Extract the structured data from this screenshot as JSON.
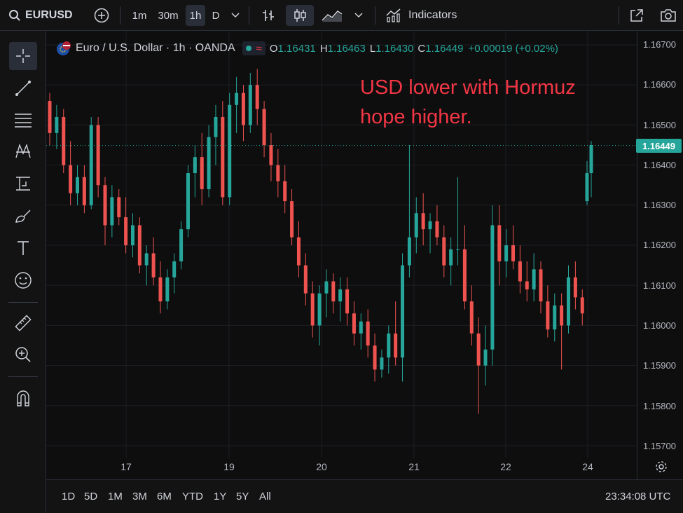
{
  "toolbar": {
    "symbol": "EURUSD",
    "intervals": [
      "1m",
      "30m",
      "1h",
      "D"
    ],
    "active_interval": "1h",
    "indicators_label": "Indicators"
  },
  "legend": {
    "title": "Euro / U.S. Dollar · 1h · OANDA",
    "o_label": "O",
    "o_value": "1.16431",
    "h_label": "H",
    "h_value": "1.16463",
    "l_label": "L",
    "l_value": "1.16430",
    "c_label": "C",
    "c_value": "1.16449",
    "change": "+0.00019 (+0.02%)"
  },
  "annotation": "USD lower with Hormuz hope higher.",
  "price_axis": {
    "ticks": [
      "1.16700",
      "1.16600",
      "1.16500",
      "1.16400",
      "1.16300",
      "1.16200",
      "1.16100",
      "1.16000",
      "1.15900",
      "1.15800",
      "1.15700"
    ],
    "last_price": "1.16449"
  },
  "time_axis": {
    "labels": [
      "17",
      "19",
      "20",
      "21",
      "22",
      "24"
    ]
  },
  "ranges": [
    "1D",
    "5D",
    "1M",
    "3M",
    "6M",
    "YTD",
    "1Y",
    "5Y",
    "All"
  ],
  "clock": "23:34:08 UTC",
  "colors": {
    "up": "#26a69a",
    "down": "#ef5350",
    "annotation": "#f23645",
    "price_label": "#26a69a"
  },
  "chart_data": {
    "type": "candlestick",
    "y_range": [
      1.1565,
      1.1675
    ],
    "last_price": 1.16449,
    "x_labels": [
      "17",
      "19",
      "20",
      "21",
      "22",
      "24"
    ],
    "ohlc": [
      [
        1.1656,
        1.1658,
        1.1645,
        1.1648
      ],
      [
        1.1648,
        1.1655,
        1.1644,
        1.1652
      ],
      [
        1.1652,
        1.1654,
        1.1638,
        1.164
      ],
      [
        1.164,
        1.1646,
        1.163,
        1.1633
      ],
      [
        1.1633,
        1.164,
        1.163,
        1.1637
      ],
      [
        1.1637,
        1.164,
        1.1628,
        1.163
      ],
      [
        1.163,
        1.1652,
        1.1629,
        1.165
      ],
      [
        1.165,
        1.1652,
        1.1632,
        1.1635
      ],
      [
        1.1635,
        1.1637,
        1.162,
        1.1625
      ],
      [
        1.1625,
        1.1635,
        1.1622,
        1.1632
      ],
      [
        1.1632,
        1.1634,
        1.1625,
        1.1627
      ],
      [
        1.1627,
        1.1632,
        1.1618,
        1.162
      ],
      [
        1.162,
        1.1628,
        1.1617,
        1.1625
      ],
      [
        1.1625,
        1.1627,
        1.1613,
        1.1615
      ],
      [
        1.1615,
        1.162,
        1.161,
        1.1618
      ],
      [
        1.1618,
        1.1622,
        1.161,
        1.1612
      ],
      [
        1.1612,
        1.1616,
        1.1603,
        1.1606
      ],
      [
        1.1606,
        1.1614,
        1.1604,
        1.1612
      ],
      [
        1.1612,
        1.1618,
        1.1608,
        1.1616
      ],
      [
        1.1616,
        1.1626,
        1.1614,
        1.1624
      ],
      [
        1.1624,
        1.164,
        1.1622,
        1.1638
      ],
      [
        1.1638,
        1.1645,
        1.1632,
        1.1642
      ],
      [
        1.1642,
        1.1648,
        1.163,
        1.1634
      ],
      [
        1.1634,
        1.165,
        1.1632,
        1.1647
      ],
      [
        1.1647,
        1.1655,
        1.164,
        1.1652
      ],
      [
        1.1652,
        1.1656,
        1.163,
        1.1632
      ],
      [
        1.1632,
        1.1658,
        1.163,
        1.1655
      ],
      [
        1.1655,
        1.1662,
        1.1648,
        1.1658
      ],
      [
        1.1658,
        1.166,
        1.1646,
        1.165
      ],
      [
        1.165,
        1.1663,
        1.1648,
        1.166
      ],
      [
        1.166,
        1.1664,
        1.165,
        1.1654
      ],
      [
        1.1654,
        1.1656,
        1.1642,
        1.1645
      ],
      [
        1.1645,
        1.1648,
        1.1636,
        1.164
      ],
      [
        1.164,
        1.1644,
        1.1632,
        1.1636
      ],
      [
        1.1636,
        1.164,
        1.1628,
        1.1631
      ],
      [
        1.1631,
        1.1634,
        1.162,
        1.1622
      ],
      [
        1.1622,
        1.1626,
        1.1612,
        1.1615
      ],
      [
        1.1615,
        1.1618,
        1.1605,
        1.1608
      ],
      [
        1.1608,
        1.1611,
        1.1597,
        1.16
      ],
      [
        1.16,
        1.161,
        1.1595,
        1.1608
      ],
      [
        1.1608,
        1.1614,
        1.1602,
        1.1611
      ],
      [
        1.1611,
        1.1613,
        1.1603,
        1.1606
      ],
      [
        1.1606,
        1.1612,
        1.1601,
        1.1609
      ],
      [
        1.1609,
        1.1612,
        1.16,
        1.1603
      ],
      [
        1.1603,
        1.1606,
        1.1595,
        1.1598
      ],
      [
        1.1598,
        1.1603,
        1.1594,
        1.1601
      ],
      [
        1.1601,
        1.1604,
        1.1592,
        1.1595
      ],
      [
        1.1595,
        1.1598,
        1.1586,
        1.1589
      ],
      [
        1.1589,
        1.1594,
        1.1587,
        1.1592
      ],
      [
        1.1592,
        1.16,
        1.1588,
        1.1598
      ],
      [
        1.1598,
        1.1606,
        1.159,
        1.1592
      ],
      [
        1.1592,
        1.1618,
        1.1586,
        1.1615
      ],
      [
        1.1615,
        1.1645,
        1.1612,
        1.1622
      ],
      [
        1.1622,
        1.1632,
        1.1618,
        1.1628
      ],
      [
        1.1628,
        1.1633,
        1.162,
        1.1624
      ],
      [
        1.1624,
        1.1628,
        1.1618,
        1.1626
      ],
      [
        1.1626,
        1.163,
        1.162,
        1.1622
      ],
      [
        1.1622,
        1.1625,
        1.1612,
        1.1615
      ],
      [
        1.1615,
        1.1622,
        1.161,
        1.1619
      ],
      [
        1.1619,
        1.1637,
        1.1615,
        1.1619
      ],
      [
        1.1619,
        1.1625,
        1.1604,
        1.1606
      ],
      [
        1.1606,
        1.161,
        1.1595,
        1.1598
      ],
      [
        1.1598,
        1.1602,
        1.1578,
        1.159
      ],
      [
        1.159,
        1.16,
        1.1585,
        1.1594
      ],
      [
        1.1594,
        1.163,
        1.159,
        1.1625
      ],
      [
        1.1625,
        1.163,
        1.161,
        1.1616
      ],
      [
        1.1616,
        1.1624,
        1.1612,
        1.162
      ],
      [
        1.162,
        1.1625,
        1.1614,
        1.1616
      ],
      [
        1.1616,
        1.162,
        1.1608,
        1.1611
      ],
      [
        1.1611,
        1.1616,
        1.1606,
        1.1609
      ],
      [
        1.1609,
        1.1618,
        1.1606,
        1.1614
      ],
      [
        1.1614,
        1.1616,
        1.1603,
        1.1606
      ],
      [
        1.1606,
        1.161,
        1.1597,
        1.1599
      ],
      [
        1.1599,
        1.1608,
        1.1596,
        1.1605
      ],
      [
        1.1605,
        1.1608,
        1.1589,
        1.16
      ],
      [
        1.16,
        1.1615,
        1.1598,
        1.1612
      ],
      [
        1.1612,
        1.1616,
        1.1604,
        1.1607
      ],
      [
        1.1607,
        1.1609,
        1.16,
        1.1603
      ],
      [
        1.1631,
        1.1641,
        1.163,
        1.1638
      ],
      [
        1.1638,
        1.1646,
        1.1632,
        1.1645
      ]
    ]
  }
}
